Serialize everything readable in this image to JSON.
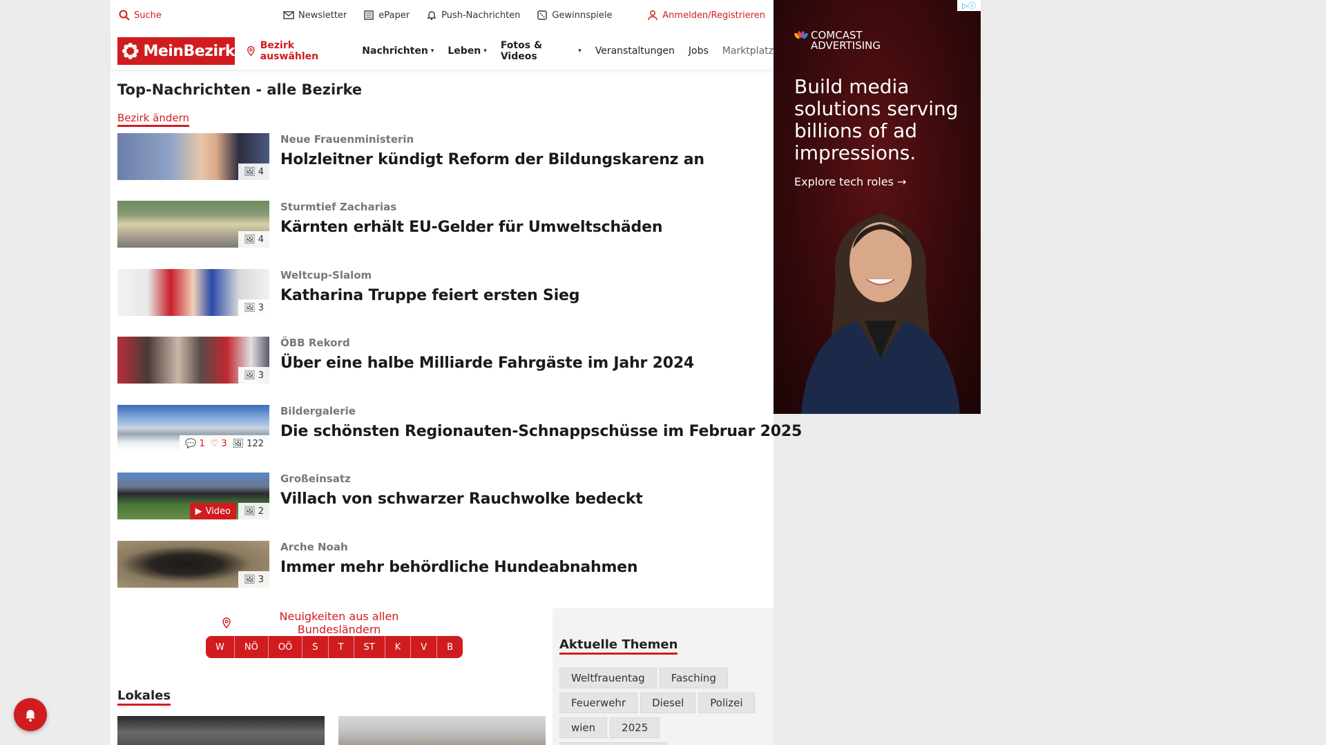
{
  "utility": {
    "search_label": "Suche",
    "newsletter": "Newsletter",
    "epaper": "ePaper",
    "push": "Push-Nachrichten",
    "gewinnspiele": "Gewinnspiele",
    "login": "Anmelden/Registrieren"
  },
  "nav": {
    "logo_text": "MeinBezirk",
    "bezirk": "Bezirk auswählen",
    "nachrichten": "Nachrichten",
    "leben": "Leben",
    "fotos": "Fotos & Videos",
    "veranstaltungen": "Veranstaltungen",
    "jobs": "Jobs",
    "marktplatz": "Marktplatz"
  },
  "main": {
    "title": "Top-Nachrichten - alle Bezirke",
    "change_link": "Bezirk ändern",
    "articles": [
      {
        "kicker": "Neue Frauenministerin",
        "headline": "Holzleitner kündigt Reform der Bildungskarenz an",
        "photos": "4"
      },
      {
        "kicker": "Sturmtief Zacharias",
        "headline": "Kärnten erhält EU-Gelder für Umweltschäden",
        "photos": "4"
      },
      {
        "kicker": "Weltcup-Slalom",
        "headline": "Katharina Truppe feiert ersten Sieg",
        "photos": "3"
      },
      {
        "kicker": "ÖBB Rekord",
        "headline": "Über eine halbe Milliarde Fahrgäste im Jahr 2024",
        "photos": "3"
      },
      {
        "kicker": "Bildergalerie",
        "headline": "Die schönsten Regionauten-Schnappschüsse im Februar 2025",
        "photos": "122",
        "comments": "1",
        "likes": "3"
      },
      {
        "kicker": "Großeinsatz",
        "headline": "Villach von schwarzer Rauchwolke bedeckt",
        "photos": "2",
        "video_label": "Video"
      },
      {
        "kicker": "Arche Noah",
        "headline": "Immer mehr behördliche Hundeabnahmen",
        "photos": "3"
      }
    ]
  },
  "states": {
    "heading": "Neuigkeiten aus allen Bundesländern",
    "items": [
      "W",
      "NÖ",
      "OÖ",
      "S",
      "T",
      "ST",
      "K",
      "V",
      "B"
    ]
  },
  "topics": {
    "title": "Aktuelle Themen",
    "tags": [
      "Weltfrauentag",
      "Fasching",
      "Feuerwehr",
      "Diesel",
      "Polizei",
      "wien",
      "2025"
    ]
  },
  "lokales": {
    "title": "Lokales"
  },
  "ad": {
    "brand_line1": "COMCAST",
    "brand_line2": "ADVERTISING",
    "headline": "Build media solutions serving billions of ad impressions.",
    "cta": "Explore tech roles →"
  },
  "colors": {
    "brand_red": "#d01c1f",
    "ad_bg": "#3a0a0c"
  }
}
